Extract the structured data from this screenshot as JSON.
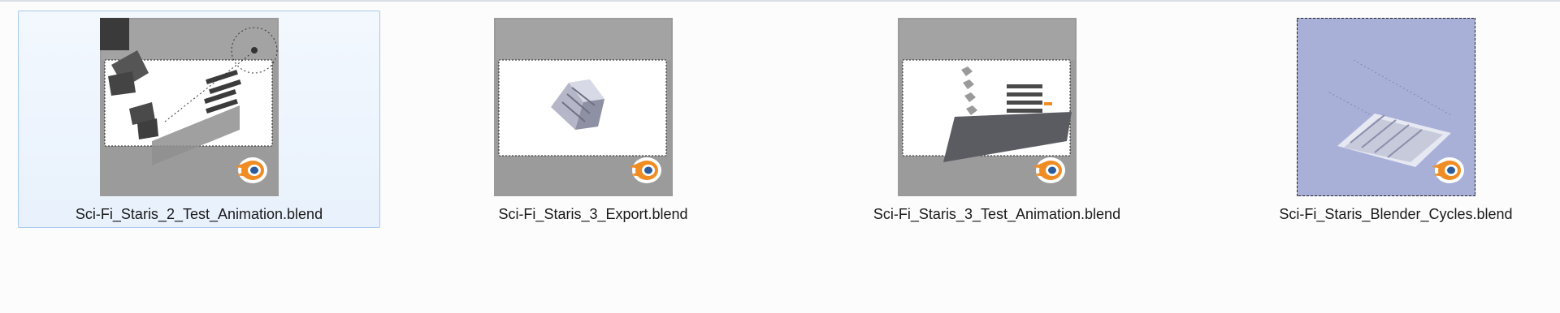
{
  "files": [
    {
      "name": "Sci-Fi_Staris_2_Test_Animation.blend",
      "selected": true,
      "thumbnail": "scene-staircase-animation"
    },
    {
      "name": "Sci-Fi_Staris_3_Export.blend",
      "selected": false,
      "thumbnail": "scene-export-mesh"
    },
    {
      "name": "Sci-Fi_Staris_3_Test_Animation.blend",
      "selected": false,
      "thumbnail": "scene-plane-animation"
    },
    {
      "name": "Sci-Fi_Staris_Blender_Cycles.blend",
      "selected": false,
      "thumbnail": "scene-cycles-render"
    }
  ],
  "icon": "blender-logo-icon",
  "colors": {
    "selection_bg": "#e8f1fc",
    "selection_border": "#a8c8ec",
    "thumb_gray": "#9b9b9b",
    "cycles_blue": "#a9b0d8",
    "blender_orange": "#f08c24",
    "blender_blue": "#2a5c9c"
  }
}
